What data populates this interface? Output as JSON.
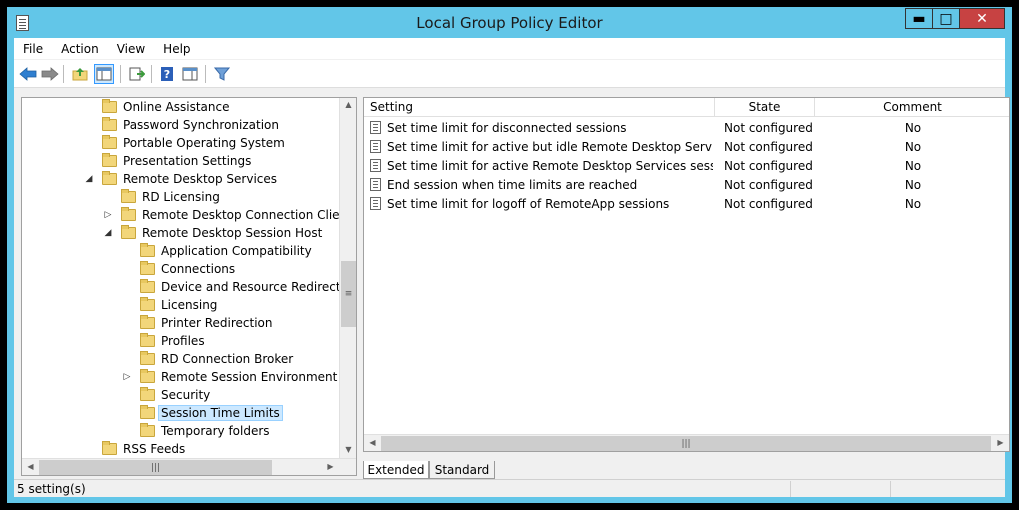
{
  "window": {
    "title": "Local Group Policy Editor",
    "minimize": "▬",
    "maximize": "□",
    "close": "✕"
  },
  "menu": {
    "file": "File",
    "action": "Action",
    "view": "View",
    "help": "Help"
  },
  "toolbar": {
    "icons": [
      "back-icon",
      "forward-icon",
      "up-folder-icon",
      "show-hide-tree-icon",
      "export-list-icon",
      "help-icon",
      "properties-view-icon",
      "filter-icon"
    ]
  },
  "tree": {
    "items": [
      {
        "label": "Online Assistance",
        "level": 0,
        "expander": ""
      },
      {
        "label": "Password Synchronization",
        "level": 0,
        "expander": ""
      },
      {
        "label": "Portable Operating System",
        "level": 0,
        "expander": ""
      },
      {
        "label": "Presentation Settings",
        "level": 0,
        "expander": ""
      },
      {
        "label": "Remote Desktop Services",
        "level": 0,
        "expander": "expanded"
      },
      {
        "label": "RD Licensing",
        "level": 1,
        "expander": ""
      },
      {
        "label": "Remote Desktop Connection Client",
        "level": 1,
        "expander": "collapsed"
      },
      {
        "label": "Remote Desktop Session Host",
        "level": 1,
        "expander": "expanded"
      },
      {
        "label": "Application Compatibility",
        "level": 2,
        "expander": ""
      },
      {
        "label": "Connections",
        "level": 2,
        "expander": ""
      },
      {
        "label": "Device and Resource Redirection",
        "level": 2,
        "expander": ""
      },
      {
        "label": "Licensing",
        "level": 2,
        "expander": ""
      },
      {
        "label": "Printer Redirection",
        "level": 2,
        "expander": ""
      },
      {
        "label": "Profiles",
        "level": 2,
        "expander": ""
      },
      {
        "label": "RD Connection Broker",
        "level": 2,
        "expander": ""
      },
      {
        "label": "Remote Session Environment",
        "level": 2,
        "expander": "collapsed"
      },
      {
        "label": "Security",
        "level": 2,
        "expander": ""
      },
      {
        "label": "Session Time Limits",
        "level": 2,
        "expander": "",
        "selected": true
      },
      {
        "label": "Temporary folders",
        "level": 2,
        "expander": ""
      },
      {
        "label": "RSS Feeds",
        "level": 0,
        "expander": ""
      }
    ]
  },
  "list": {
    "columns": {
      "setting": "Setting",
      "state": "State",
      "comment": "Comment"
    },
    "rows": [
      {
        "setting": "Set time limit for disconnected sessions",
        "state": "Not configured",
        "comment": "No"
      },
      {
        "setting": "Set time limit for active but idle Remote Desktop Services se...",
        "state": "Not configured",
        "comment": "No"
      },
      {
        "setting": "Set time limit for active Remote Desktop Services sessions",
        "state": "Not configured",
        "comment": "No"
      },
      {
        "setting": "End session when time limits are reached",
        "state": "Not configured",
        "comment": "No"
      },
      {
        "setting": "Set time limit for logoff of RemoteApp sessions",
        "state": "Not configured",
        "comment": "No"
      }
    ]
  },
  "tabs": {
    "extended": "Extended",
    "standard": "Standard"
  },
  "status": {
    "text": "5 setting(s)"
  },
  "colors": {
    "titlebar": "#62c6e8",
    "close_button": "#c74242",
    "selection": "#cce8ff"
  }
}
